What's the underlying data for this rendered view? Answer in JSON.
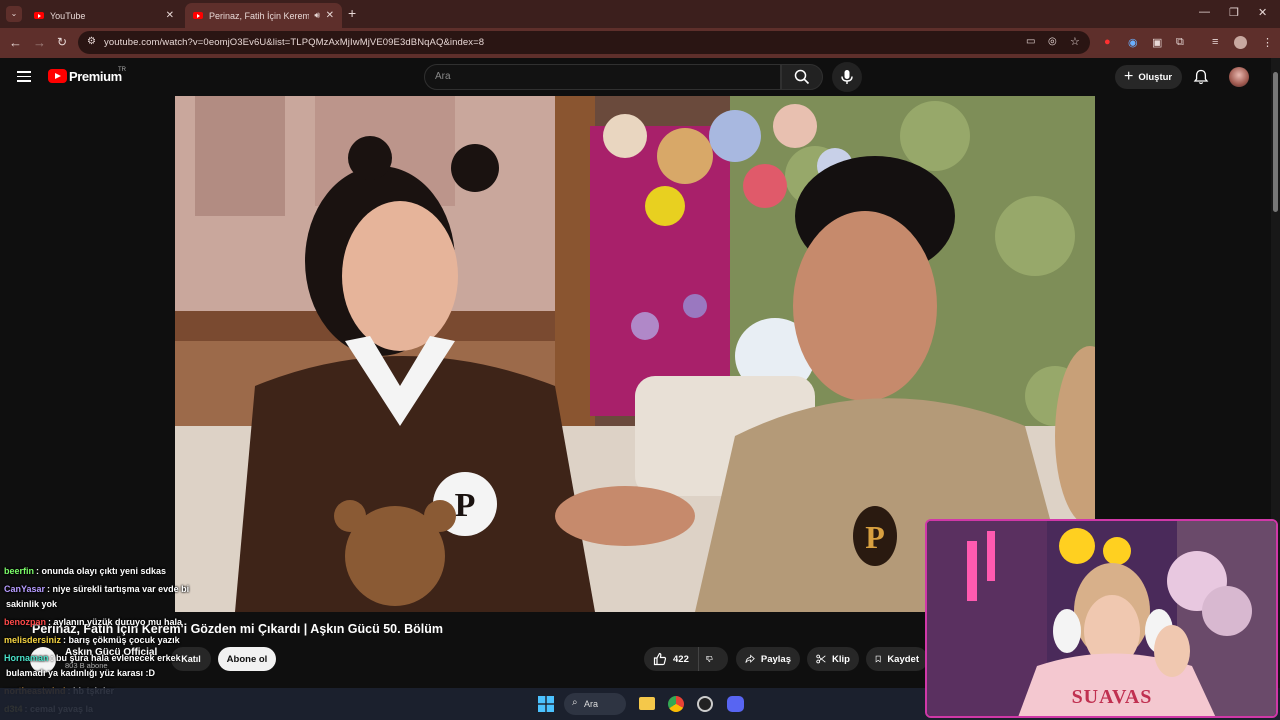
{
  "browser": {
    "tabs": [
      {
        "title": "YouTube",
        "active": false
      },
      {
        "title": "Perinaz, Fatih İçin Kerem'i G",
        "active": true
      }
    ],
    "url": "youtube.com/watch?v=0eomjO3Ev6U&list=TLPQMzAxMjIwMjVE09E3dBNqAQ&index=8"
  },
  "header": {
    "logo_text": "Premium",
    "region": "TR",
    "search_placeholder": "Ara",
    "create_label": "Oluştur"
  },
  "video": {
    "title": "Perinaz, Fatih İçin Kerem'i Gözden mi Çıkardı | Aşkın Gücü 50. Bölüm",
    "channel": "Aşkın Gücü Official",
    "subscribers": "803 B abone",
    "join_label": "Katıl",
    "subscribe_label": "Abone ol",
    "likes": "422",
    "share_label": "Paylaş",
    "clip_label": "Klip",
    "save_label": "Kaydet"
  },
  "chat": [
    {
      "user": "beerfin",
      "color": "#7cfc6a",
      "text": ": onunda olayı çıktı yeni sdkas"
    },
    {
      "user": "CanYasar",
      "color": "#b69bff",
      "text": ": niye sürekli tartışma var evde bi"
    },
    {
      "user": "",
      "color": "#ffffff",
      "text": "sakinlik yok"
    },
    {
      "user": "benozpan",
      "color": "#ff4a4a",
      "text": ": aylanın yüzük duruyo mu hala"
    },
    {
      "user": "melisdersiniz",
      "color": "#f5d442",
      "text": ": barış çökmüş çocuk yazık"
    },
    {
      "user": "Hornaman",
      "color": "#4ae0c8",
      "text": ": bu şura hala evlenecek erkek"
    },
    {
      "user": "",
      "color": "#ffffff",
      "text": "bulamadı ya kadınlığı yüz karası :D"
    },
    {
      "user": "northeastwind",
      "color": "#ffb347",
      "text": ": hb tşkrler"
    },
    {
      "user": "d3t4",
      "color": "#ffe24a",
      "text": ": cemal yavaş la"
    }
  ],
  "taskbar": {
    "search_label": "Ara"
  },
  "colors": {
    "chrome_frame": "#3c1f1d",
    "chrome_toolbar": "#5e2f2b",
    "youtube_red": "#ff0000",
    "cam_border": "#d038a8"
  }
}
